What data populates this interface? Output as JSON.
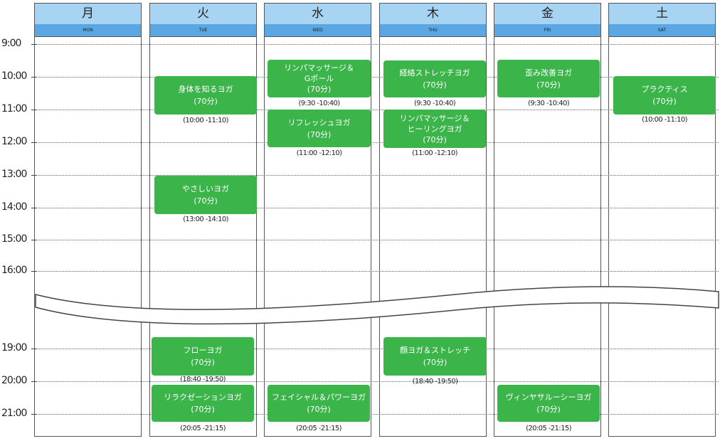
{
  "days": [
    {
      "jp": "月",
      "en": "MON"
    },
    {
      "jp": "火",
      "en": "TUE"
    },
    {
      "jp": "水",
      "en": "WED"
    },
    {
      "jp": "木",
      "en": "THU"
    },
    {
      "jp": "金",
      "en": "FRI"
    },
    {
      "jp": "土",
      "en": "SAT"
    }
  ],
  "times": [
    "9:00",
    "10:00",
    "11:00",
    "12:00",
    "13:00",
    "14:00",
    "15:00",
    "16:00",
    "19:00",
    "20:00",
    "21:00"
  ],
  "classes": {
    "tue_1": {
      "name": "身体を知るヨガ",
      "duration": "(70分)",
      "time": "(10:00 -11:10)"
    },
    "tue_2": {
      "name": "やさしいヨガ",
      "duration": "(70分)",
      "time": "(13:00 -14:10)"
    },
    "tue_3": {
      "name": "フローヨガ",
      "duration": "(70分)",
      "time": "(18:40 -19:50)"
    },
    "tue_4": {
      "name": "リラクゼーションヨガ",
      "duration": "(70分)",
      "time": "(20:05 -21:15)"
    },
    "wed_1": {
      "name_1": "リンパマッサージ＆",
      "name_2": "Gポール",
      "duration": "(70分)",
      "time": "(9:30 -10:40)"
    },
    "wed_2": {
      "name": "リフレッシュヨガ",
      "duration": "(70分)",
      "time": "(11:00 -12:10)"
    },
    "wed_3": {
      "name": "フェイシャル＆パワーヨガ",
      "duration": "(70分)",
      "time": "(20:05 -21:15)"
    },
    "thu_1": {
      "name": "経絡ストレッチヨガ",
      "duration": "(70分)",
      "time": "(9:30 -10:40)"
    },
    "thu_2": {
      "name_1": "リンパマッサージ＆",
      "name_2": "ヒーリングヨガ",
      "duration": "(70分)",
      "time": "(11:00 -12:10)"
    },
    "thu_3": {
      "name": "顔ヨガ＆ストレッチ",
      "duration": "(70分)",
      "time": "(18:40 -19:50)"
    },
    "fri_1": {
      "name": "歪み改善ヨガ",
      "duration": "(70分)",
      "time": "(9:30 -10:40)"
    },
    "fri_2": {
      "name": "ヴィンヤサルーシーヨガ",
      "duration": "(70分)",
      "time": "(20:05 -21:15)"
    },
    "sat_1": {
      "name": "プラクティス",
      "duration": "(70分)",
      "time": "(10:00 -11:10)"
    }
  },
  "colors": {
    "class_green": "#3bb54a",
    "header_light": "#a8d4f3",
    "header_dark": "#5aa7e3"
  }
}
